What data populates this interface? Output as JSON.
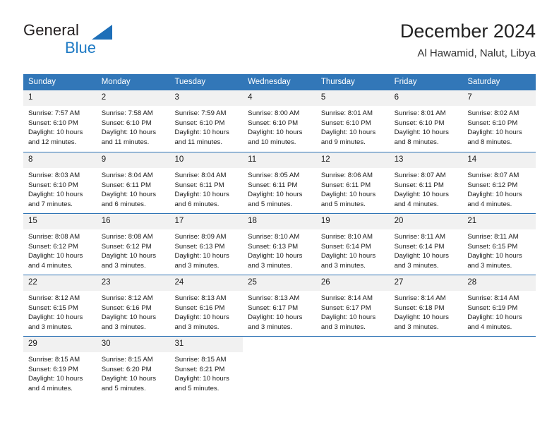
{
  "brand": {
    "name_top": "General",
    "name_bottom": "Blue",
    "accent_color": "#1e7ac4",
    "triangle_color": "#1e6fb8"
  },
  "header": {
    "title": "December 2024",
    "subtitle": "Al Hawamid, Nalut, Libya"
  },
  "theme": {
    "header_row_bg": "#3277b8",
    "header_row_text": "#ffffff",
    "daynum_bg": "#f1f1f1",
    "week_separator": "#2f74b5",
    "body_text": "#1a1a1a"
  },
  "weekdays": [
    "Sunday",
    "Monday",
    "Tuesday",
    "Wednesday",
    "Thursday",
    "Friday",
    "Saturday"
  ],
  "weeks": [
    [
      {
        "day": "1",
        "sunrise": "Sunrise: 7:57 AM",
        "sunset": "Sunset: 6:10 PM",
        "daylight1": "Daylight: 10 hours",
        "daylight2": "and 12 minutes."
      },
      {
        "day": "2",
        "sunrise": "Sunrise: 7:58 AM",
        "sunset": "Sunset: 6:10 PM",
        "daylight1": "Daylight: 10 hours",
        "daylight2": "and 11 minutes."
      },
      {
        "day": "3",
        "sunrise": "Sunrise: 7:59 AM",
        "sunset": "Sunset: 6:10 PM",
        "daylight1": "Daylight: 10 hours",
        "daylight2": "and 11 minutes."
      },
      {
        "day": "4",
        "sunrise": "Sunrise: 8:00 AM",
        "sunset": "Sunset: 6:10 PM",
        "daylight1": "Daylight: 10 hours",
        "daylight2": "and 10 minutes."
      },
      {
        "day": "5",
        "sunrise": "Sunrise: 8:01 AM",
        "sunset": "Sunset: 6:10 PM",
        "daylight1": "Daylight: 10 hours",
        "daylight2": "and 9 minutes."
      },
      {
        "day": "6",
        "sunrise": "Sunrise: 8:01 AM",
        "sunset": "Sunset: 6:10 PM",
        "daylight1": "Daylight: 10 hours",
        "daylight2": "and 8 minutes."
      },
      {
        "day": "7",
        "sunrise": "Sunrise: 8:02 AM",
        "sunset": "Sunset: 6:10 PM",
        "daylight1": "Daylight: 10 hours",
        "daylight2": "and 8 minutes."
      }
    ],
    [
      {
        "day": "8",
        "sunrise": "Sunrise: 8:03 AM",
        "sunset": "Sunset: 6:10 PM",
        "daylight1": "Daylight: 10 hours",
        "daylight2": "and 7 minutes."
      },
      {
        "day": "9",
        "sunrise": "Sunrise: 8:04 AM",
        "sunset": "Sunset: 6:11 PM",
        "daylight1": "Daylight: 10 hours",
        "daylight2": "and 6 minutes."
      },
      {
        "day": "10",
        "sunrise": "Sunrise: 8:04 AM",
        "sunset": "Sunset: 6:11 PM",
        "daylight1": "Daylight: 10 hours",
        "daylight2": "and 6 minutes."
      },
      {
        "day": "11",
        "sunrise": "Sunrise: 8:05 AM",
        "sunset": "Sunset: 6:11 PM",
        "daylight1": "Daylight: 10 hours",
        "daylight2": "and 5 minutes."
      },
      {
        "day": "12",
        "sunrise": "Sunrise: 8:06 AM",
        "sunset": "Sunset: 6:11 PM",
        "daylight1": "Daylight: 10 hours",
        "daylight2": "and 5 minutes."
      },
      {
        "day": "13",
        "sunrise": "Sunrise: 8:07 AM",
        "sunset": "Sunset: 6:11 PM",
        "daylight1": "Daylight: 10 hours",
        "daylight2": "and 4 minutes."
      },
      {
        "day": "14",
        "sunrise": "Sunrise: 8:07 AM",
        "sunset": "Sunset: 6:12 PM",
        "daylight1": "Daylight: 10 hours",
        "daylight2": "and 4 minutes."
      }
    ],
    [
      {
        "day": "15",
        "sunrise": "Sunrise: 8:08 AM",
        "sunset": "Sunset: 6:12 PM",
        "daylight1": "Daylight: 10 hours",
        "daylight2": "and 4 minutes."
      },
      {
        "day": "16",
        "sunrise": "Sunrise: 8:08 AM",
        "sunset": "Sunset: 6:12 PM",
        "daylight1": "Daylight: 10 hours",
        "daylight2": "and 3 minutes."
      },
      {
        "day": "17",
        "sunrise": "Sunrise: 8:09 AM",
        "sunset": "Sunset: 6:13 PM",
        "daylight1": "Daylight: 10 hours",
        "daylight2": "and 3 minutes."
      },
      {
        "day": "18",
        "sunrise": "Sunrise: 8:10 AM",
        "sunset": "Sunset: 6:13 PM",
        "daylight1": "Daylight: 10 hours",
        "daylight2": "and 3 minutes."
      },
      {
        "day": "19",
        "sunrise": "Sunrise: 8:10 AM",
        "sunset": "Sunset: 6:14 PM",
        "daylight1": "Daylight: 10 hours",
        "daylight2": "and 3 minutes."
      },
      {
        "day": "20",
        "sunrise": "Sunrise: 8:11 AM",
        "sunset": "Sunset: 6:14 PM",
        "daylight1": "Daylight: 10 hours",
        "daylight2": "and 3 minutes."
      },
      {
        "day": "21",
        "sunrise": "Sunrise: 8:11 AM",
        "sunset": "Sunset: 6:15 PM",
        "daylight1": "Daylight: 10 hours",
        "daylight2": "and 3 minutes."
      }
    ],
    [
      {
        "day": "22",
        "sunrise": "Sunrise: 8:12 AM",
        "sunset": "Sunset: 6:15 PM",
        "daylight1": "Daylight: 10 hours",
        "daylight2": "and 3 minutes."
      },
      {
        "day": "23",
        "sunrise": "Sunrise: 8:12 AM",
        "sunset": "Sunset: 6:16 PM",
        "daylight1": "Daylight: 10 hours",
        "daylight2": "and 3 minutes."
      },
      {
        "day": "24",
        "sunrise": "Sunrise: 8:13 AM",
        "sunset": "Sunset: 6:16 PM",
        "daylight1": "Daylight: 10 hours",
        "daylight2": "and 3 minutes."
      },
      {
        "day": "25",
        "sunrise": "Sunrise: 8:13 AM",
        "sunset": "Sunset: 6:17 PM",
        "daylight1": "Daylight: 10 hours",
        "daylight2": "and 3 minutes."
      },
      {
        "day": "26",
        "sunrise": "Sunrise: 8:14 AM",
        "sunset": "Sunset: 6:17 PM",
        "daylight1": "Daylight: 10 hours",
        "daylight2": "and 3 minutes."
      },
      {
        "day": "27",
        "sunrise": "Sunrise: 8:14 AM",
        "sunset": "Sunset: 6:18 PM",
        "daylight1": "Daylight: 10 hours",
        "daylight2": "and 3 minutes."
      },
      {
        "day": "28",
        "sunrise": "Sunrise: 8:14 AM",
        "sunset": "Sunset: 6:19 PM",
        "daylight1": "Daylight: 10 hours",
        "daylight2": "and 4 minutes."
      }
    ],
    [
      {
        "day": "29",
        "sunrise": "Sunrise: 8:15 AM",
        "sunset": "Sunset: 6:19 PM",
        "daylight1": "Daylight: 10 hours",
        "daylight2": "and 4 minutes."
      },
      {
        "day": "30",
        "sunrise": "Sunrise: 8:15 AM",
        "sunset": "Sunset: 6:20 PM",
        "daylight1": "Daylight: 10 hours",
        "daylight2": "and 5 minutes."
      },
      {
        "day": "31",
        "sunrise": "Sunrise: 8:15 AM",
        "sunset": "Sunset: 6:21 PM",
        "daylight1": "Daylight: 10 hours",
        "daylight2": "and 5 minutes."
      },
      {
        "day": "",
        "sunrise": "",
        "sunset": "",
        "daylight1": "",
        "daylight2": ""
      },
      {
        "day": "",
        "sunrise": "",
        "sunset": "",
        "daylight1": "",
        "daylight2": ""
      },
      {
        "day": "",
        "sunrise": "",
        "sunset": "",
        "daylight1": "",
        "daylight2": ""
      },
      {
        "day": "",
        "sunrise": "",
        "sunset": "",
        "daylight1": "",
        "daylight2": ""
      }
    ]
  ]
}
